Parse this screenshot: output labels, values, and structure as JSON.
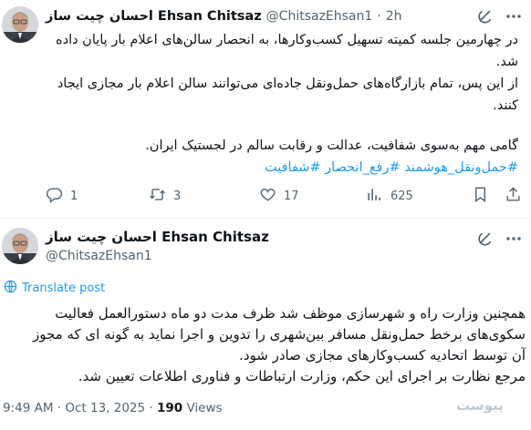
{
  "tweet1": {
    "name": "احسان چیت ساز Ehsan Chitsaz",
    "handle": "@ChitsazEhsan1",
    "separator": "·",
    "time": "2h",
    "lines": [
      "در چهارمین جلسه کمیته تسهیل کسب‌وکارها، به انحصار سالن‌های اعلام بار پایان داده",
      "شد.",
      "از این پس، تمام بازارگاه‌های حمل‌ونقل جاده‌ای می‌توانند سالن  اعلام بار مجازی ایجاد",
      "کنند.",
      "گامی مهم به‌سوی شفافیت، عدالت و رقابت سالم در لجستیک ایران.",
      "#حمل‌ونقل_هوشمند #رفع_انحصار #شفافیت"
    ],
    "actions": {
      "replies": "1",
      "reposts": "3",
      "likes": "17",
      "views": "625"
    }
  },
  "tweet2": {
    "name": "احسان چیت ساز Ehsan Chitsaz",
    "handle": "@ChitsazEhsan1",
    "translate_label": "Translate post",
    "lines": [
      "همچنین وزارت راه و شهرسازی موظف شد ظرف مدت دو ماه دستورالعمل فعالیت",
      "سکوی‌های برخط حمل‌ونقل مسافر بین‌شهری را تدوین و اجرا نماید به گونه ای که مجوز",
      "آن  توسط اتحادیه کسب‌وکارهای مجازی صادر شود.",
      "مرجع نظارت بر اجرای این حکم، وزارت ارتباطات و فناوری اطلاعات تعیین شد."
    ],
    "timestamp": "9:49 AM · Oct 13, 2025 · ",
    "views_count": "190",
    "views_label": " Views"
  },
  "watermark": "پیوست",
  "colors": {
    "text": "#0f1419",
    "secondary": "#536471",
    "link": "#1d9bf0",
    "divider": "#eff3f4"
  },
  "icons": {
    "grok": "grok-icon",
    "more": "more-icon",
    "reply": "reply-icon",
    "repost": "repost-icon",
    "like": "like-icon",
    "views": "views-icon",
    "bookmark": "bookmark-icon",
    "share": "share-icon",
    "translate": "globe-icon"
  }
}
